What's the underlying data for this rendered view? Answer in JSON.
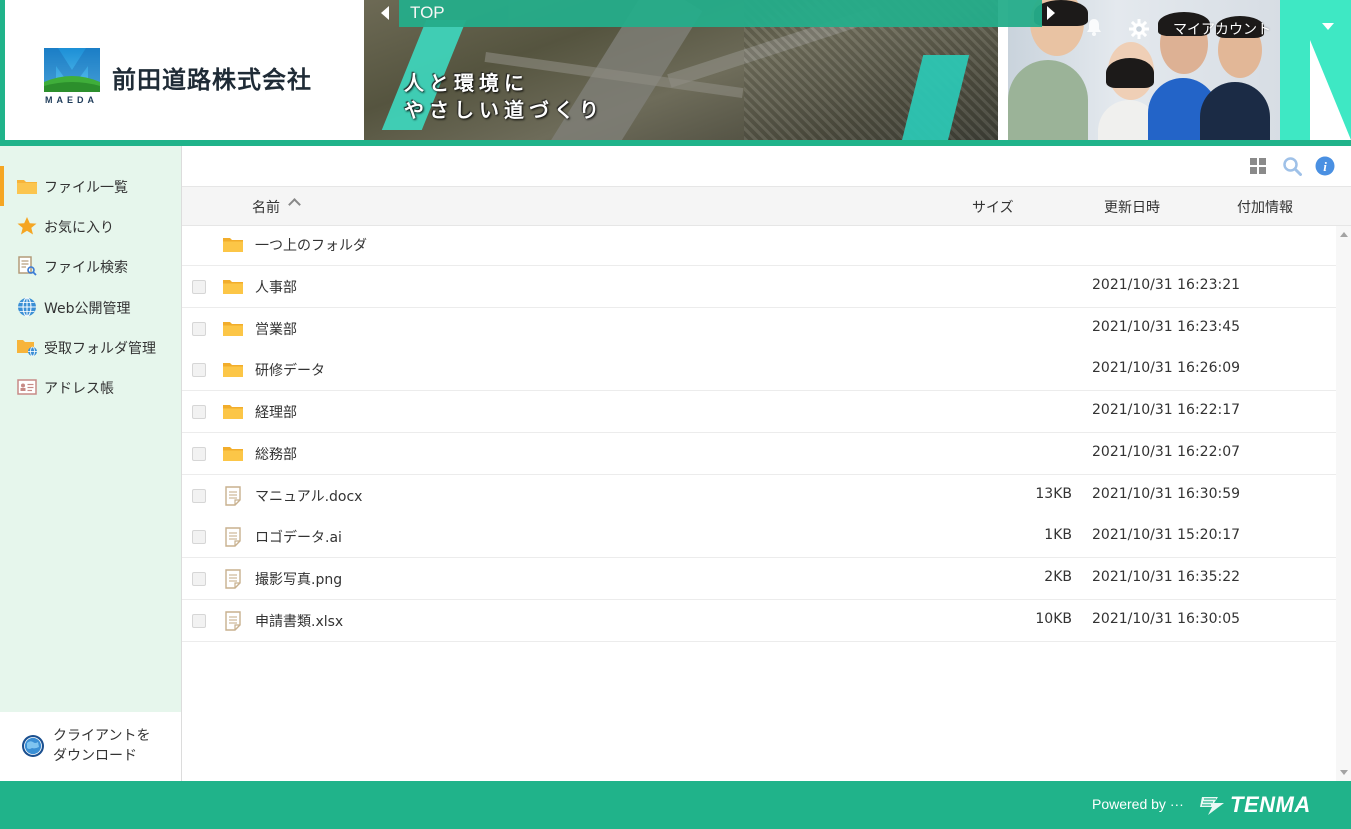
{
  "colors": {
    "brand_green": "#20b38a",
    "sidebar_bg": "#e6f6ec",
    "active_indicator": "#f5a623",
    "folder_yellow": "#f7c14b",
    "info_blue": "#4a90e2"
  },
  "header": {
    "company_name": "前田道路株式会社",
    "logo_sub": "MAEDA",
    "slogan_line1": "人と環境に",
    "slogan_line2": "やさしい道づくり",
    "breadcrumb": "TOP",
    "account_label": "マイアカウント"
  },
  "sidebar": {
    "items": [
      {
        "label": "ファイル一覧",
        "icon": "folder-icon"
      },
      {
        "label": "お気に入り",
        "icon": "star-icon"
      },
      {
        "label": "ファイル検索",
        "icon": "file-search-icon"
      },
      {
        "label": "Web公開管理",
        "icon": "globe-icon"
      },
      {
        "label": "受取フォルダ管理",
        "icon": "receive-folder-icon"
      },
      {
        "label": "アドレス帳",
        "icon": "address-book-icon"
      }
    ],
    "download_line1": "クライアントを",
    "download_line2": "ダウンロード"
  },
  "toolbar": {
    "icons": [
      "grid-view-icon",
      "search-icon",
      "info-icon"
    ]
  },
  "table": {
    "headers": {
      "name": "名前",
      "size": "サイズ",
      "modified": "更新日時",
      "extra": "付加情報"
    },
    "parent_folder": "一つ上のフォルダ",
    "rows": [
      {
        "name": "人事部",
        "type": "folder",
        "size": "",
        "modified": "2021/10/31 16:23:21"
      },
      {
        "name": "営業部",
        "type": "folder",
        "size": "",
        "modified": "2021/10/31 16:23:45"
      },
      {
        "name": "研修データ",
        "type": "folder",
        "size": "",
        "modified": "2021/10/31 16:26:09"
      },
      {
        "name": "経理部",
        "type": "folder",
        "size": "",
        "modified": "2021/10/31 16:22:17"
      },
      {
        "name": "総務部",
        "type": "folder",
        "size": "",
        "modified": "2021/10/31 16:22:07"
      },
      {
        "name": "マニュアル.docx",
        "type": "file",
        "size": "13KB",
        "modified": "2021/10/31 16:30:59"
      },
      {
        "name": "ロゴデータ.ai",
        "type": "file",
        "size": "1KB",
        "modified": "2021/10/31 15:20:17"
      },
      {
        "name": "撮影写真.png",
        "type": "file",
        "size": "2KB",
        "modified": "2021/10/31 16:35:22"
      },
      {
        "name": "申請書類.xlsx",
        "type": "file",
        "size": "10KB",
        "modified": "2021/10/31 16:30:05"
      }
    ]
  },
  "footer": {
    "powered_by": "Powered by ···",
    "product": "TENMA"
  }
}
